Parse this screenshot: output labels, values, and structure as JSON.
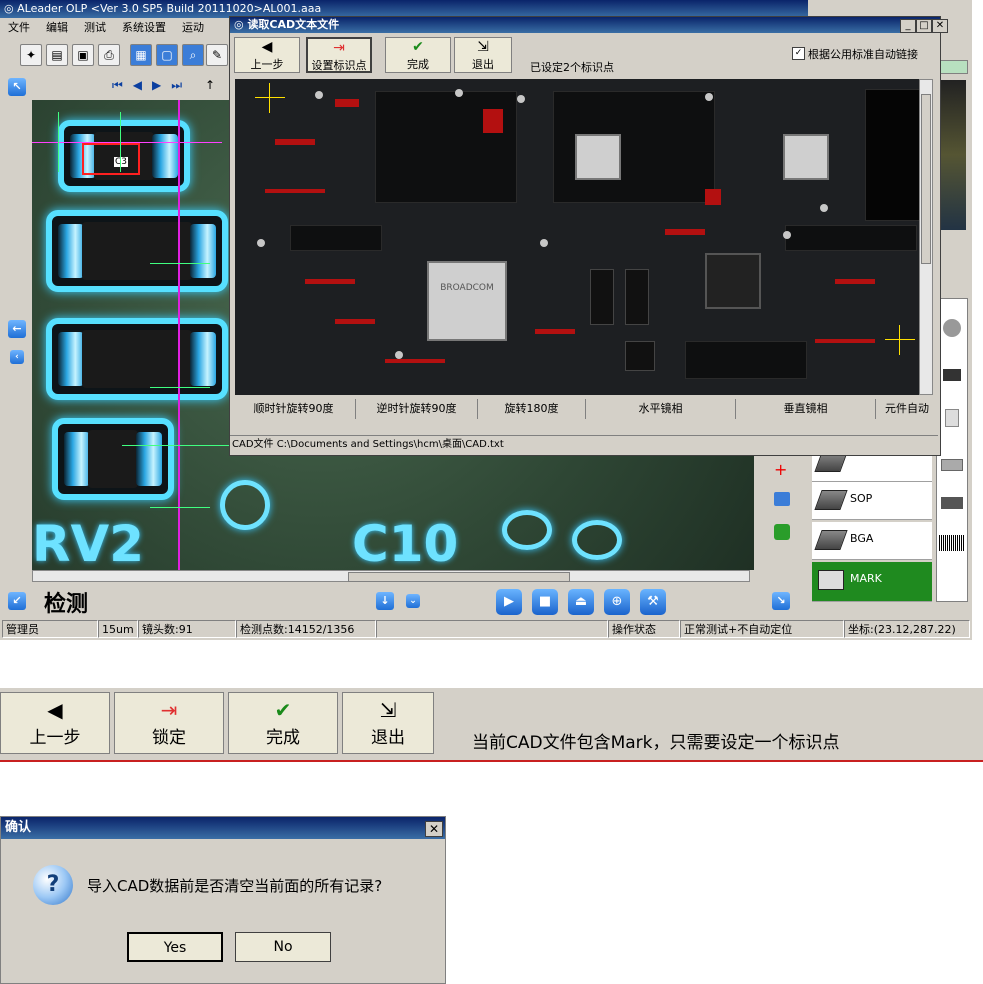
{
  "main": {
    "title": "ALeader OLP  <Ver 3.0 SP5  Build 20111020>AL001.aaa",
    "menu": [
      "文件",
      "编辑",
      "测试",
      "系统设置",
      "运动"
    ],
    "camera_label": "检测",
    "silk_labels": [
      "RV2",
      "C10"
    ],
    "box_label": "C3",
    "status": [
      "管理员",
      "15um",
      "镜头数:91",
      "检测点数:14152/1356",
      "操作状态",
      "正常测试+不自动定位",
      "坐标:(23.12,287.22)"
    ]
  },
  "cad_dialog": {
    "title": "读取CAD文本文件",
    "buttons": [
      "上一步",
      "设置标识点",
      "完成",
      "退出"
    ],
    "hint": "已设定2个标识点",
    "checkbox_label": "根据公用标准自动链接",
    "checkbox_checked": true,
    "pcb_chip_label": "BROADCOM",
    "rotate_buttons": [
      "顺时针旋转90度",
      "逆时针旋转90度",
      "旋转180度",
      "水平镜相",
      "垂直镜相",
      "元件自动"
    ],
    "file_path": "CAD文件 C:\\Documents and Settings\\hcm\\桌面\\CAD.txt"
  },
  "side_panel": {
    "items": [
      "SOP",
      "BGA",
      "MARK"
    ],
    "selected": "MARK",
    "accent_color": "#1f8a1f"
  },
  "toolbar2": {
    "buttons": [
      "上一步",
      "锁定",
      "完成",
      "退出"
    ],
    "message": "当前CAD文件包含Mark，只需要设定一个标识点"
  },
  "confirm": {
    "title": "确认",
    "message": "导入CAD数据前是否清空当前面的所有记录?",
    "yes": "Yes",
    "no": "No"
  }
}
